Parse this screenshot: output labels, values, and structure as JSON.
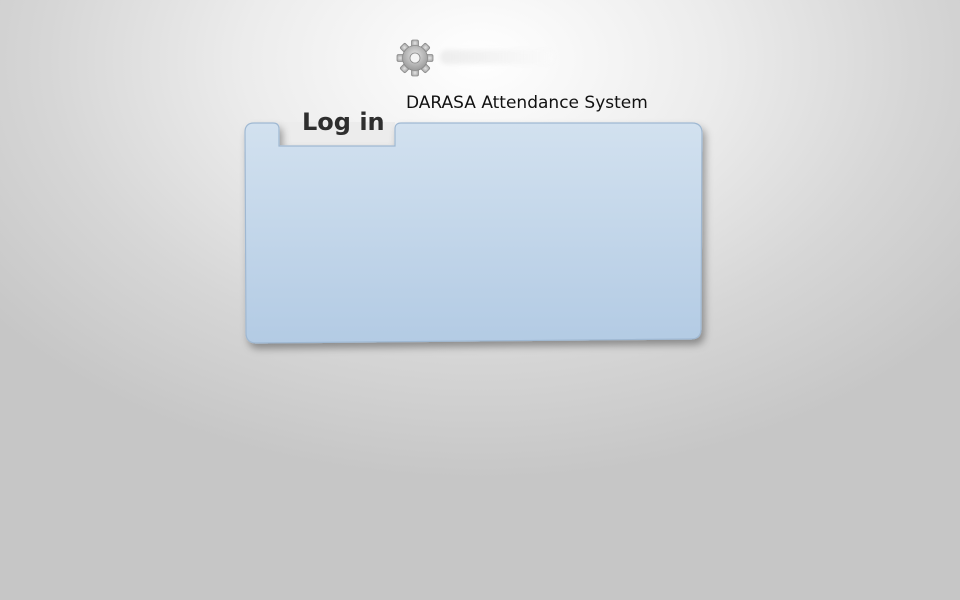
{
  "app": {
    "title": "DARASA Attendance System",
    "logo_icon": "gear-icon"
  },
  "login_panel": {
    "tab_label": "Log in"
  },
  "colors": {
    "panel_top": "#d2e1ef",
    "panel_bottom": "#b3cbe4",
    "panel_border": "#9fb8d2",
    "tab_background": "#ececec"
  }
}
